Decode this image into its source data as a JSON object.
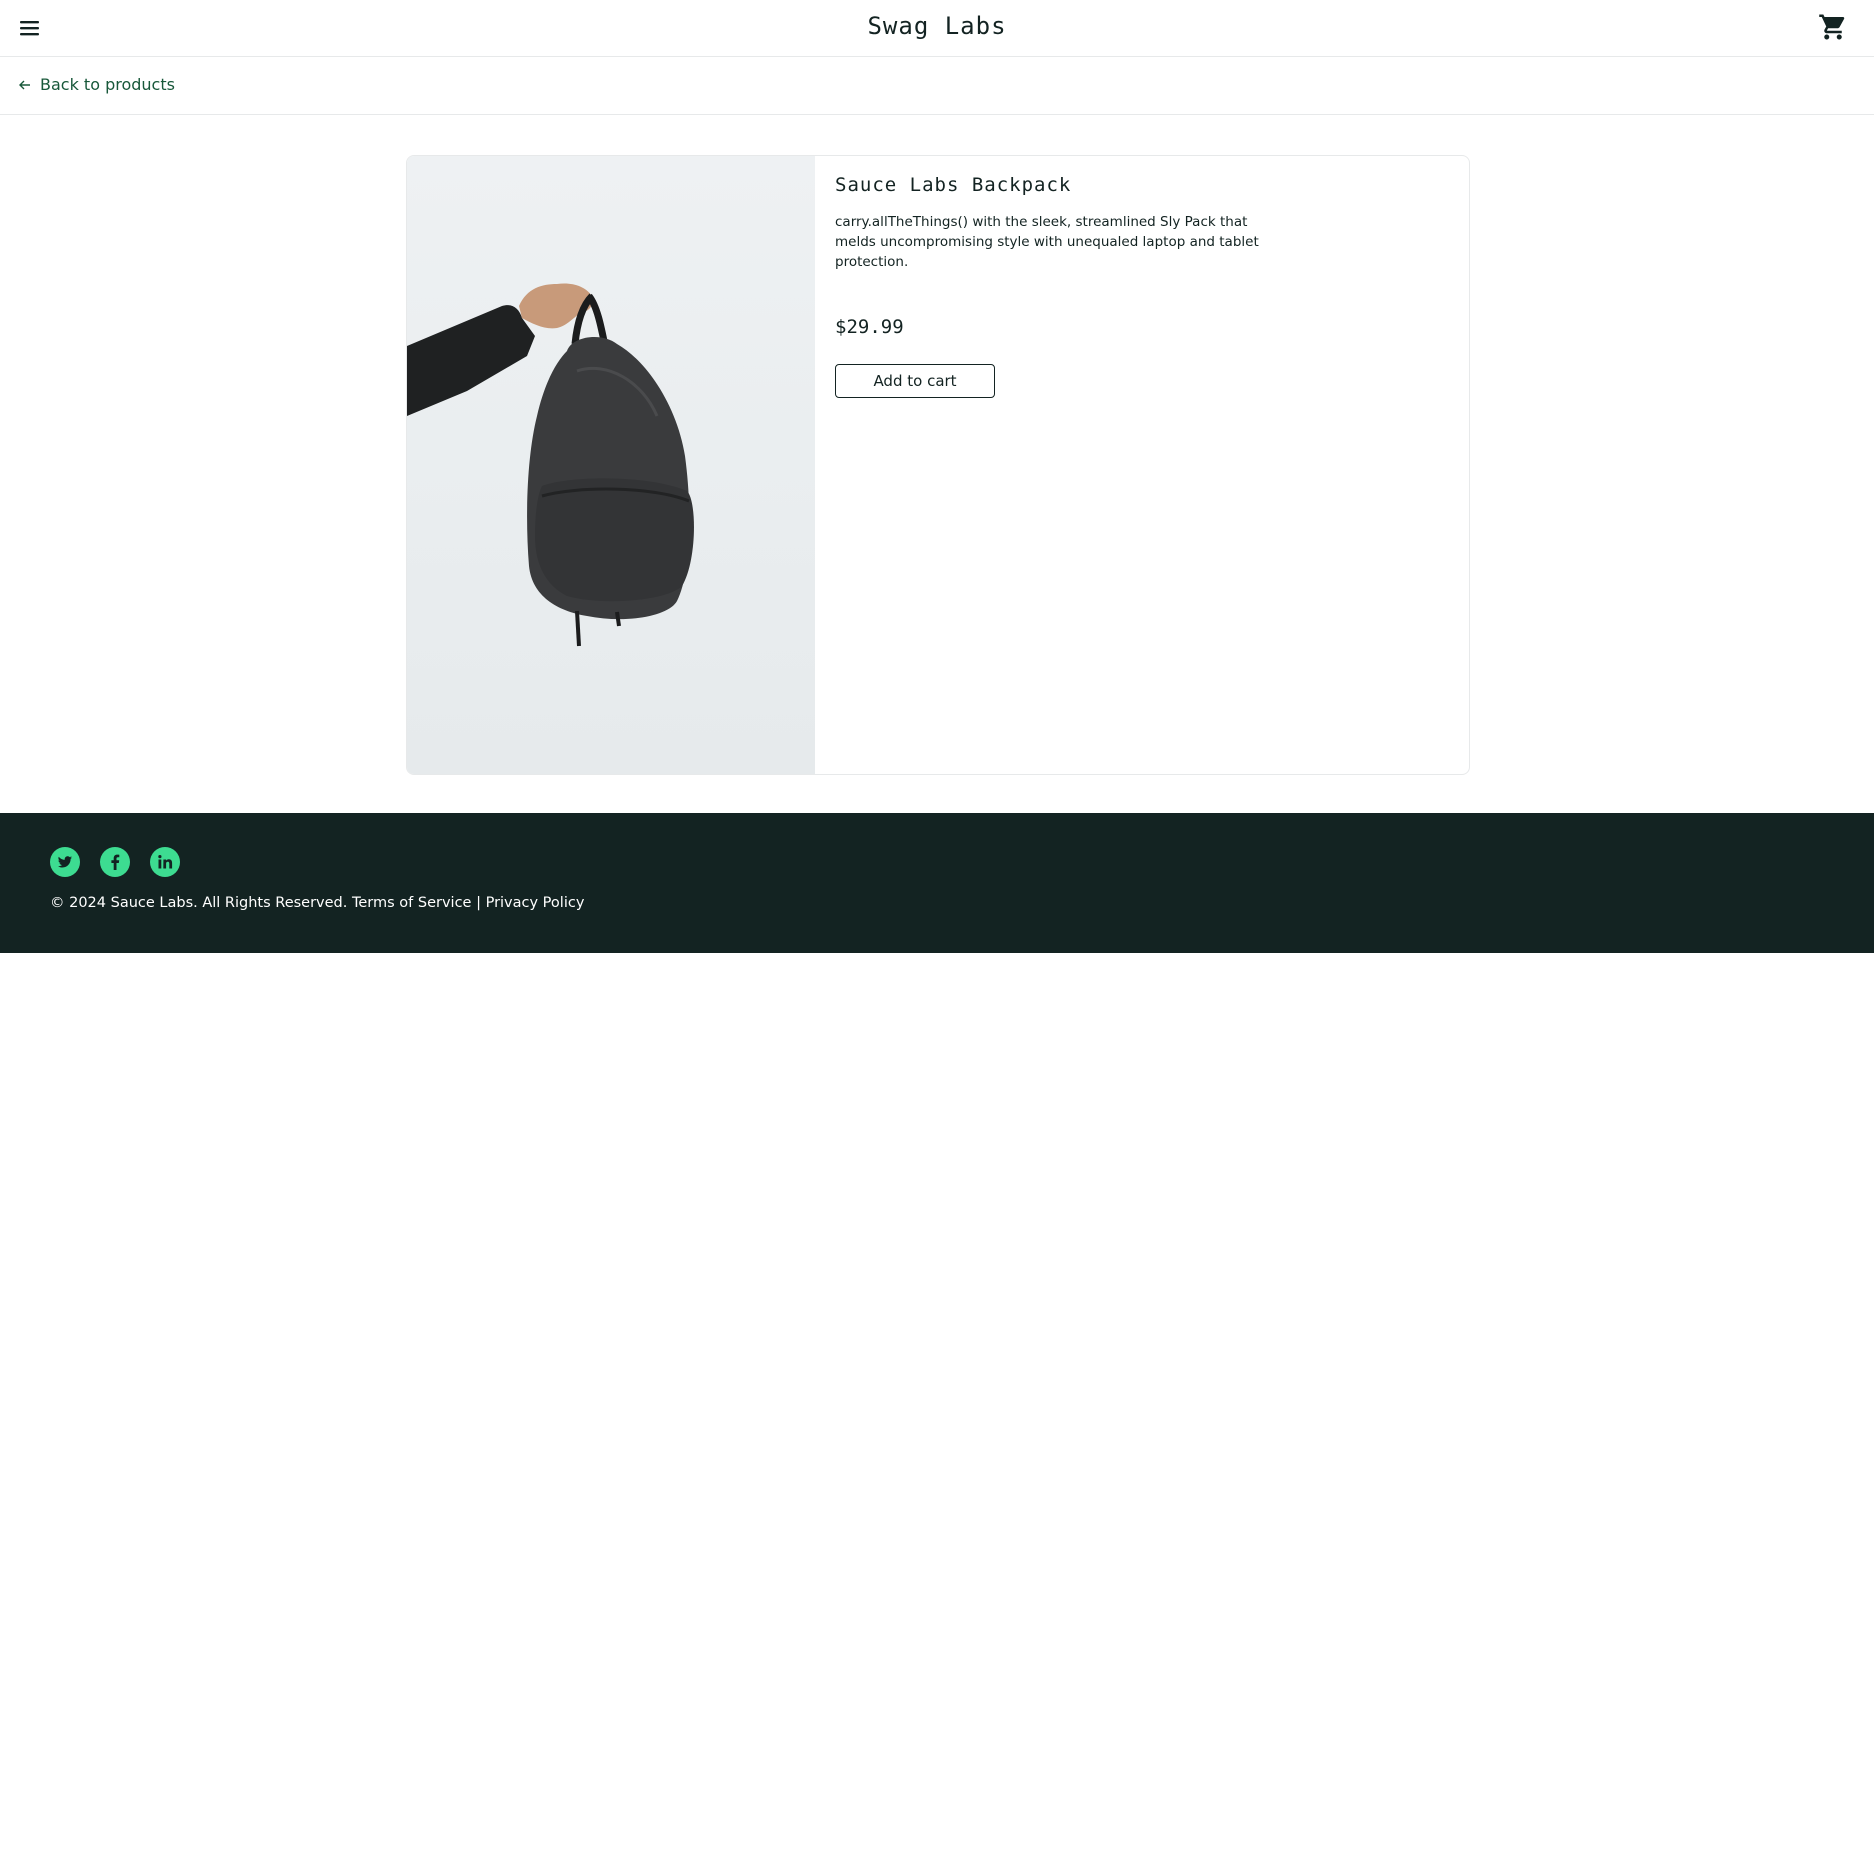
{
  "header": {
    "title": "Swag Labs",
    "menu_icon": "hamburger-menu-icon",
    "cart_icon": "shopping-cart-icon"
  },
  "subheader": {
    "back_label": "Back to products",
    "back_icon": "arrow-left-icon"
  },
  "product": {
    "name": "Sauce Labs Backpack",
    "description": "carry.allTheThings() with the sleek, streamlined Sly Pack that melds uncompromising style with unequaled laptop and tablet protection.",
    "price": "$29.99",
    "add_to_cart_label": "Add to cart"
  },
  "footer": {
    "social": [
      {
        "icon": "twitter-icon"
      },
      {
        "icon": "facebook-icon"
      },
      {
        "icon": "linkedin-icon"
      }
    ],
    "copyright": "© 2024 Sauce Labs. All Rights Reserved.",
    "terms": "Terms of Service",
    "separator": "|",
    "privacy": "Privacy Policy"
  },
  "colors": {
    "accent_green": "#3ddc91",
    "footer_bg": "#132322",
    "link_green": "#18583a",
    "text_dark": "#132322"
  }
}
